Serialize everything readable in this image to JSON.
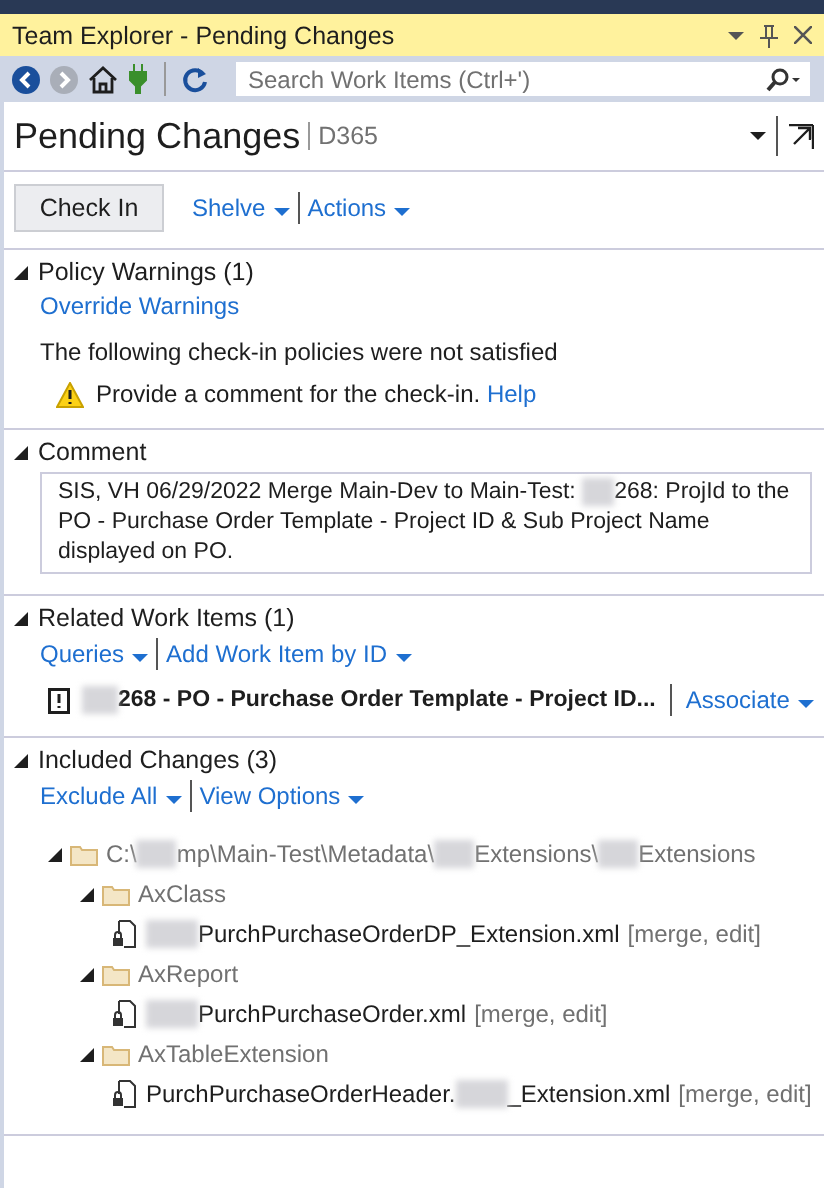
{
  "window": {
    "title": "Team Explorer - Pending Changes"
  },
  "toolbar": {
    "search": {
      "placeholder": "Search Work Items (Ctrl+')"
    }
  },
  "page": {
    "title": "Pending Changes",
    "context": "D365"
  },
  "actions": {
    "primary": "Check In",
    "links": [
      "Shelve",
      "Actions"
    ]
  },
  "sections": [
    {
      "kind": "policy",
      "title": "Policy Warnings (1)",
      "expanded": true,
      "link": "Override Warnings",
      "message": "The following check-in policies were not satisfied",
      "warning": {
        "text": "Provide a comment for the check-in.",
        "help": "Help"
      }
    },
    {
      "kind": "comment",
      "title": "Comment",
      "expanded": true,
      "segments": [
        "SIS, VH 06/29/2022 Merge Main-Dev to Main-Test: ",
        "268: ProjId to the PO - Purchase Order Template - Project ID & Sub Project Name displayed on PO."
      ]
    },
    {
      "kind": "workitems",
      "title": "Related Work Items (1)",
      "expanded": true,
      "links": [
        "Queries",
        "Add Work Item by ID"
      ],
      "item": {
        "leading_blur": true,
        "segments": [
          "268 - PO - Purchase Order Template - Project ID..."
        ],
        "action": "Associate"
      }
    },
    {
      "kind": "changes",
      "title": "Included Changes (3)",
      "expanded": true,
      "links": [
        "Exclude All",
        "View Options"
      ],
      "tree": [
        {
          "kind": "folder",
          "segments": [
            "C:\\",
            "mp\\Main-Test\\Metadata\\",
            "Extensions\\",
            "Extensions"
          ],
          "expanded": true,
          "children": [
            {
              "kind": "folder",
              "segments": [
                "AxClass"
              ],
              "expanded": true,
              "children": [
                {
                  "kind": "file",
                  "leading_blur": true,
                  "segments": [
                    "PurchPurchaseOrderDP_Extension.xml"
                  ],
                  "status": "[merge, edit]"
                }
              ]
            },
            {
              "kind": "folder",
              "segments": [
                "AxReport"
              ],
              "expanded": true,
              "children": [
                {
                  "kind": "file",
                  "leading_blur": true,
                  "segments": [
                    "PurchPurchaseOrder.xml"
                  ],
                  "status": "[merge, edit]"
                }
              ]
            },
            {
              "kind": "folder",
              "segments": [
                "AxTableExtension"
              ],
              "expanded": true,
              "children": [
                {
                  "kind": "file",
                  "segments": [
                    "PurchPurchaseOrderHeader.",
                    "_Extension.xml"
                  ],
                  "status": "[merge, edit]"
                }
              ]
            }
          ]
        }
      ]
    }
  ]
}
